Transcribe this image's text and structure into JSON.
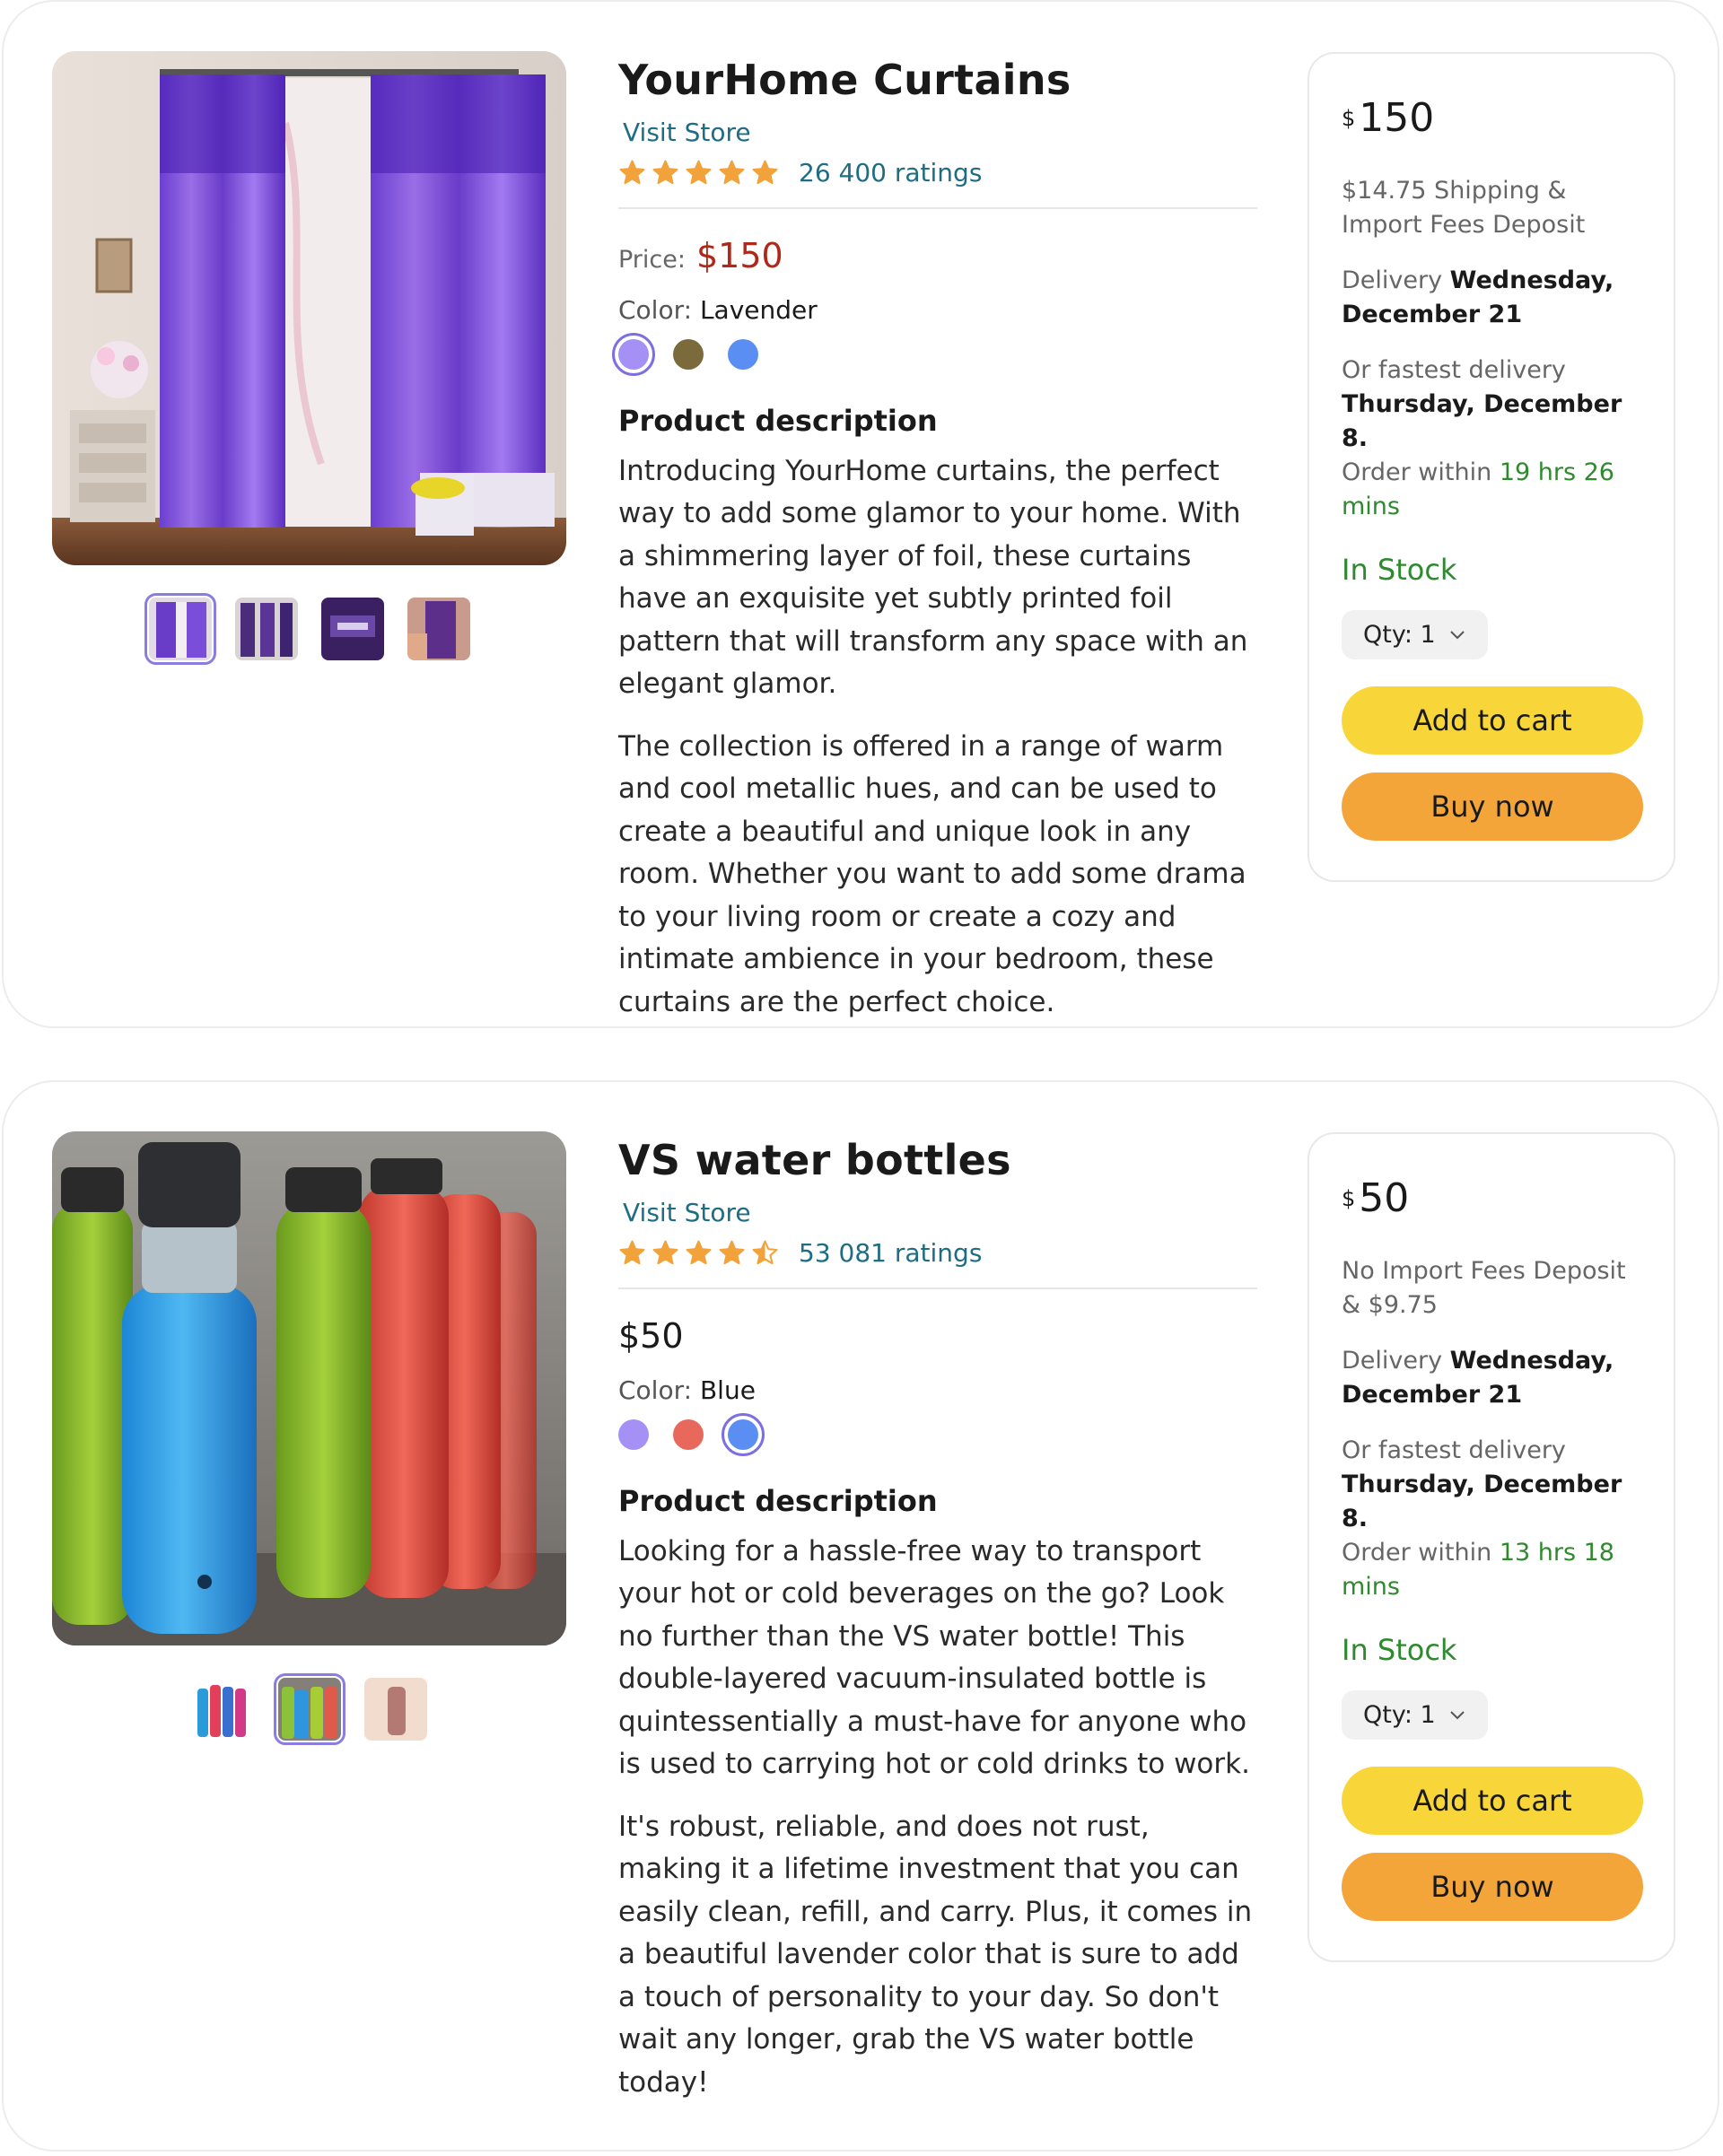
{
  "products": [
    {
      "title": "YourHome Curtains",
      "visit_store": "Visit Store",
      "rating_stars": 5,
      "ratings_text": "26 400 ratings",
      "price_label": "Price:",
      "price": "$150",
      "color_label": "Color:",
      "color_name": "Lavender",
      "swatches": [
        "#a590f5",
        "#7a6a3c",
        "#5a8ef2"
      ],
      "selected_swatch": 0,
      "thumbnails": 4,
      "selected_thumbnail": 0,
      "description_heading": "Product description",
      "description": [
        "Introducing YourHome curtains, the perfect way to add some glamor to your home. With a shimmering layer of foil, these curtains have an exquisite yet subtly printed foil pattern that will transform any space with an elegant glamor.",
        "The collection is offered in a range of warm and cool metallic hues, and can be used to create a beautiful and unique look in any room. Whether you want to add some drama to your living room or create a cozy and intimate ambience in your bedroom, these curtains are the perfect choice."
      ],
      "buybox": {
        "currency": "$",
        "amount": "150",
        "shipping": "$14.75 Shipping & Import Fees Deposit",
        "delivery_label": "Delivery",
        "delivery_date": "Wednesday, December 21",
        "fastest_label": "Or fastest delivery",
        "fastest_date": "Thursday, December 8.",
        "order_within_label": "Order within",
        "order_within_time": "19 hrs 26 mins",
        "stock": "In Stock",
        "qty": "Qty: 1",
        "add_to_cart": "Add to cart",
        "buy_now": "Buy now"
      }
    },
    {
      "title": "VS water bottles",
      "visit_store": "Visit Store",
      "rating_stars": 4.5,
      "ratings_text": "53 081 ratings",
      "price": "$50",
      "color_label": "Color:",
      "color_name": "Blue",
      "swatches": [
        "#a590f5",
        "#e8695c",
        "#5a8ef2"
      ],
      "selected_swatch": 2,
      "thumbnails": 3,
      "selected_thumbnail": 1,
      "description_heading": "Product description",
      "description": [
        "Looking for a hassle-free way to transport your hot or cold beverages on the go? Look no further than the VS water bottle! This double-layered vacuum-insulated bottle is quintessentially a must-have for anyone who is used to carrying hot or cold drinks to work.",
        "It's robust, reliable, and does not rust, making it a lifetime investment that you can easily clean, refill, and carry. Plus, it comes in a beautiful lavender color that is sure to add a touch of personality to your day. So don't wait any longer, grab the VS water bottle today!"
      ],
      "buybox": {
        "currency": "$",
        "amount": "50",
        "shipping": "No Import Fees Deposit & $9.75",
        "delivery_label": "Delivery",
        "delivery_date": "Wednesday, December 21",
        "fastest_label": "Or fastest delivery",
        "fastest_date": "Thursday, December 8.",
        "order_within_label": "Order within",
        "order_within_time": "13 hrs 18 mins",
        "stock": "In Stock",
        "qty": "Qty: 1",
        "add_to_cart": "Add to cart",
        "buy_now": "Buy now"
      }
    }
  ],
  "colors": {
    "link": "#1e6d84",
    "price_red": "#b0281b",
    "star": "#f2a23a",
    "green": "#2f8a2f",
    "add_to_cart_bg": "#f8d63a",
    "buy_now_bg": "#f3a53a"
  },
  "icons": {
    "rating": "star-icon",
    "qty_dropdown": "chevron-down-icon"
  }
}
